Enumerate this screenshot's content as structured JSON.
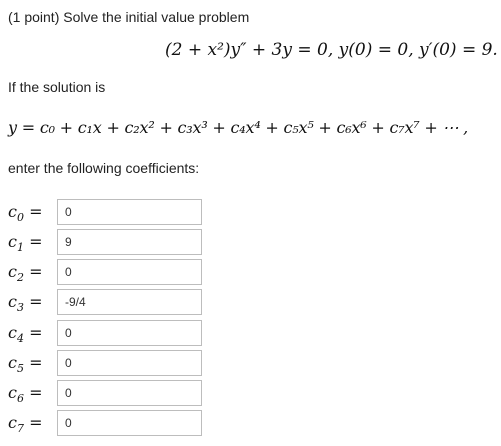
{
  "problem": {
    "intro": "(1 point) Solve the initial value problem",
    "equation": "(2 + x²)y″ + 3y = 0,  y(0) = 0,  y′(0) = 9.",
    "if_solution": "If the solution is",
    "series": "y = c₀ + c₁x + c₂x² + c₃x³ + c₄x⁴ + c₅x⁵ + c₆x⁶ + c₇x⁷ + ⋯ ,",
    "enter": "enter the following coefficients:"
  },
  "coefficients": [
    {
      "label": "c",
      "sub": "0",
      "eq": "=",
      "value": "0"
    },
    {
      "label": "c",
      "sub": "1",
      "eq": "=",
      "value": "9"
    },
    {
      "label": "c",
      "sub": "2",
      "eq": "=",
      "value": "0"
    },
    {
      "label": "c",
      "sub": "3",
      "eq": "=",
      "value": "-9/4"
    },
    {
      "label": "c",
      "sub": "4",
      "eq": "=",
      "value": "0"
    },
    {
      "label": "c",
      "sub": "5",
      "eq": "=",
      "value": "0"
    },
    {
      "label": "c",
      "sub": "6",
      "eq": "=",
      "value": "0"
    },
    {
      "label": "c",
      "sub": "7",
      "eq": "=",
      "value": "0"
    }
  ]
}
